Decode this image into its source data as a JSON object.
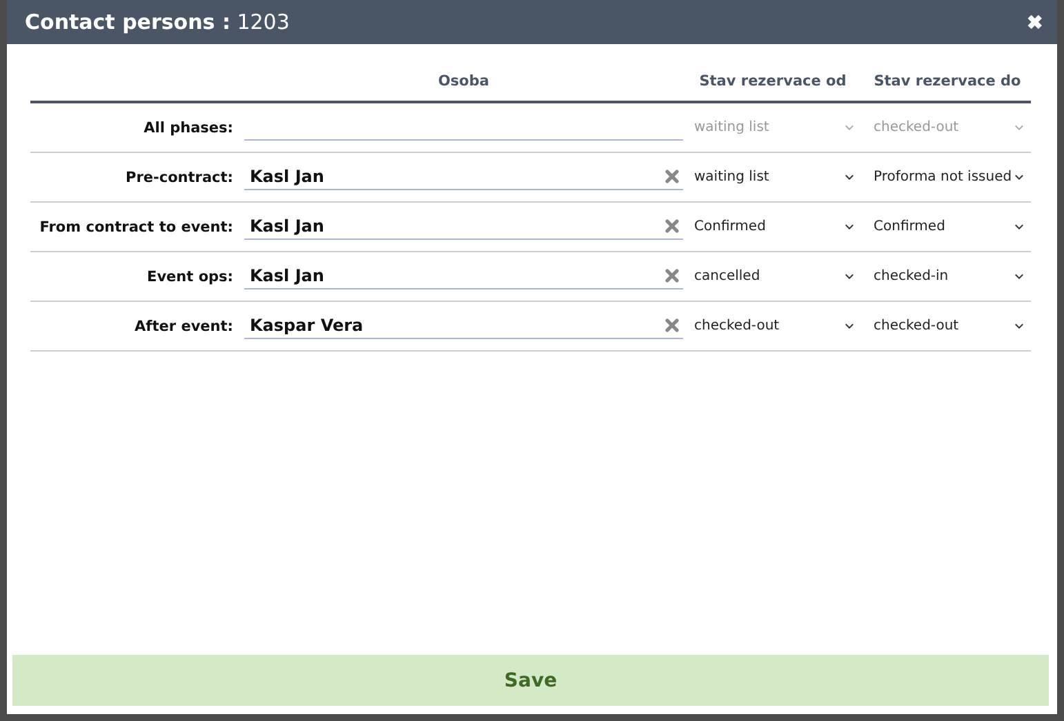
{
  "dialog": {
    "title": "Contact persons :",
    "record_number": "1203",
    "close_icon": "✖"
  },
  "table": {
    "columns": [
      "Osoba",
      "Stav rezervace od",
      "Stav rezervace do"
    ],
    "rows": [
      {
        "phase": "All phases:",
        "disabled": true,
        "status_from": "waiting list",
        "status_to": "checked-out"
      },
      {
        "phase": "Pre-contract:",
        "disabled": false,
        "person": "Kasl Jan",
        "status_from": "waiting list",
        "status_to": "Proforma not issued"
      },
      {
        "phase": "From contract to event:",
        "disabled": false,
        "person": "Kasl Jan",
        "status_from": "Confirmed",
        "status_to": "Confirmed"
      },
      {
        "phase": "Event ops:",
        "disabled": false,
        "person": "Kasl Jan",
        "status_from": "cancelled",
        "status_to": "checked-in"
      },
      {
        "phase": "After event:",
        "disabled": false,
        "person": "Kaspar Vera",
        "status_from": "checked-out",
        "status_to": "checked-out"
      }
    ]
  },
  "save_button": "Save"
}
